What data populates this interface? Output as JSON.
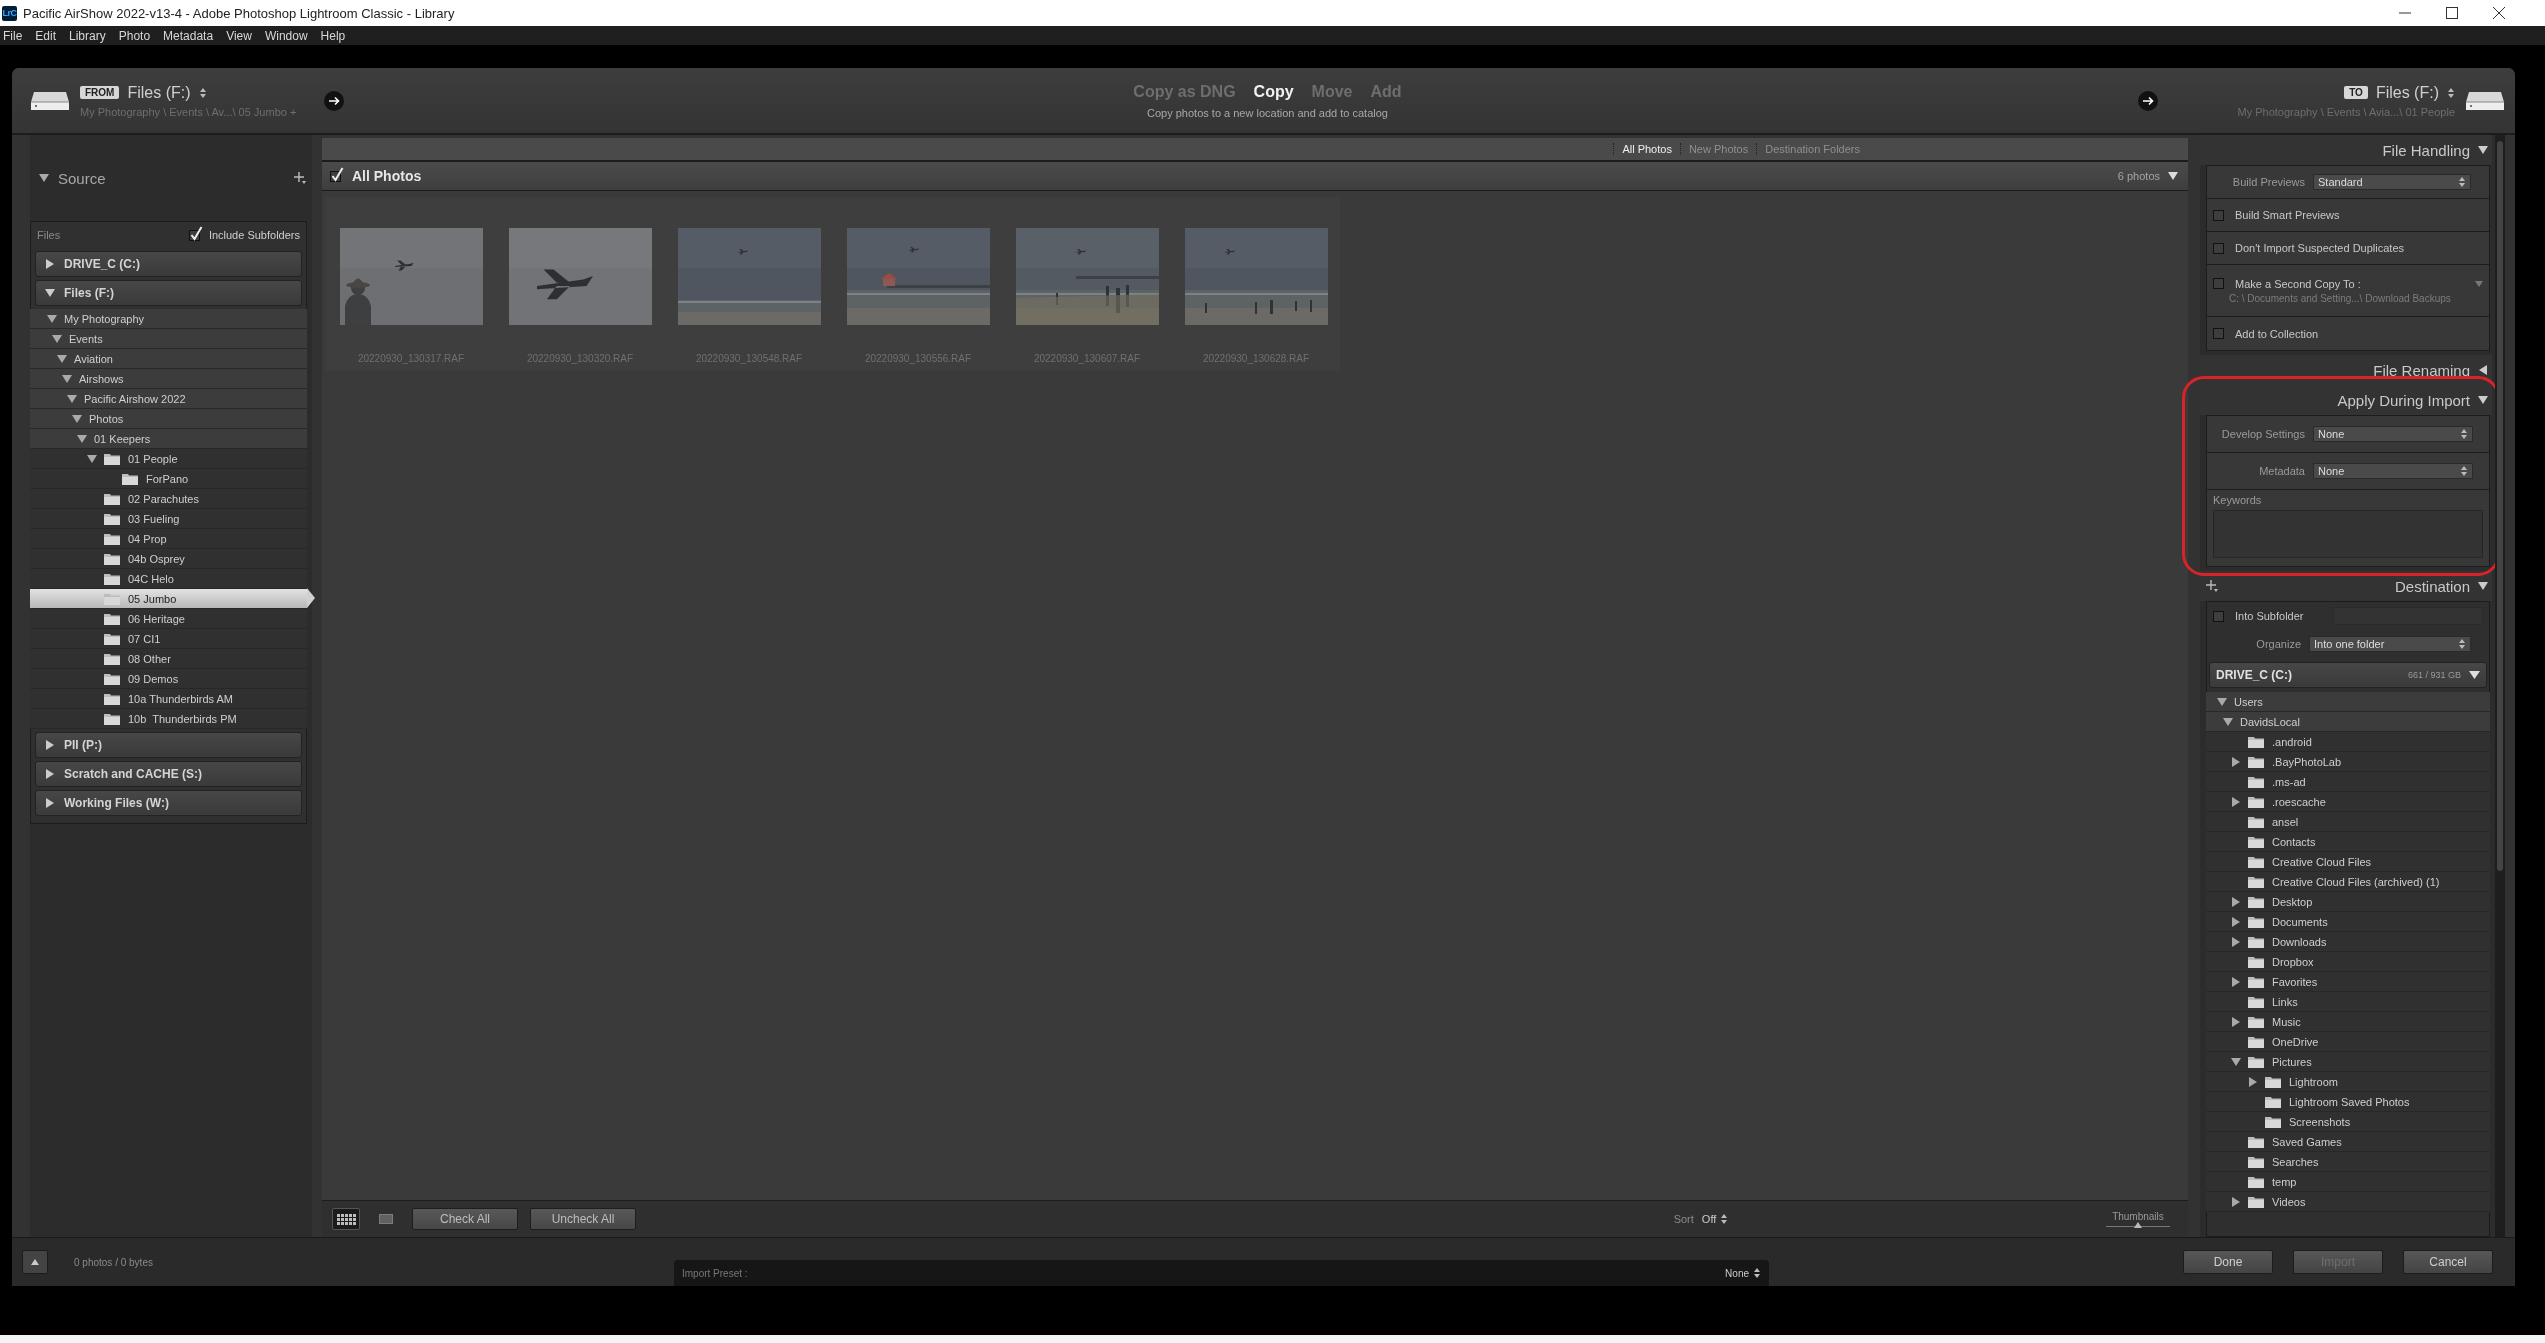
{
  "window": {
    "app_icon": "LrC",
    "title": "Pacific AirShow 2022-v13-4 - Adobe Photoshop Lightroom Classic - Library"
  },
  "menu": [
    "File",
    "Edit",
    "Library",
    "Photo",
    "Metadata",
    "View",
    "Window",
    "Help"
  ],
  "import_header": {
    "from": {
      "badge": "FROM",
      "volume": "Files (F:)",
      "path": "My Photography \\ Events \\ Av...\\ 05 Jumbo +"
    },
    "modes": [
      {
        "label": "Copy as DNG",
        "selected": false
      },
      {
        "label": "Copy",
        "selected": true
      },
      {
        "label": "Move",
        "selected": false
      },
      {
        "label": "Add",
        "selected": false
      }
    ],
    "mode_description": "Copy photos to a new location and add to catalog",
    "to": {
      "badge": "TO",
      "volume": "Files (F:)",
      "path": "My Photography \\ Events \\ Avia...\\ 01 People"
    }
  },
  "source": {
    "title": "Source",
    "files_label": "Files",
    "include_subfolders": {
      "label": "Include Subfolders",
      "checked": true
    },
    "volumes": [
      {
        "name": "DRIVE_C (C:)",
        "expanded": false
      },
      {
        "name": "Files (F:)",
        "expanded": true,
        "children": [
          {
            "name": "My Photography",
            "kind": "path",
            "selected": false,
            "expanded": true,
            "children": [
              {
                "name": "Events",
                "kind": "path",
                "selected": false,
                "expanded": true,
                "children": [
                  {
                    "name": "Aviation",
                    "kind": "path",
                    "selected": false,
                    "expanded": true,
                    "children": [
                      {
                        "name": "Airshows",
                        "kind": "path",
                        "selected": false,
                        "expanded": true,
                        "children": [
                          {
                            "name": "Pacific Airshow 2022",
                            "kind": "path",
                            "selected": false,
                            "expanded": true,
                            "children": [
                              {
                                "name": "Photos",
                                "kind": "path",
                                "selected": false,
                                "expanded": true,
                                "children": [
                                  {
                                    "name": "01 Keepers",
                                    "kind": "path",
                                    "selected": false,
                                    "expanded": true,
                                    "children": [
                                      {
                                        "name": "01 People",
                                        "kind": "folder",
                                        "selected": false,
                                        "expanded": true,
                                        "children": [
                                          {
                                            "name": "ForPano",
                                            "kind": "folder",
                                            "selected": false
                                          }
                                        ]
                                      },
                                      {
                                        "name": "02 Parachutes",
                                        "kind": "folder",
                                        "selected": false
                                      },
                                      {
                                        "name": "03 Fueling",
                                        "kind": "folder",
                                        "selected": false
                                      },
                                      {
                                        "name": "04 Prop",
                                        "kind": "folder",
                                        "selected": false
                                      },
                                      {
                                        "name": "04b Osprey",
                                        "kind": "folder",
                                        "selected": false
                                      },
                                      {
                                        "name": "04C Helo",
                                        "kind": "folder",
                                        "selected": false
                                      },
                                      {
                                        "name": "05 Jumbo",
                                        "kind": "folder",
                                        "selected": true
                                      },
                                      {
                                        "name": "06 Heritage",
                                        "kind": "folder",
                                        "selected": false
                                      },
                                      {
                                        "name": "07 CI1",
                                        "kind": "folder",
                                        "selected": false
                                      },
                                      {
                                        "name": "08 Other",
                                        "kind": "folder",
                                        "selected": false
                                      },
                                      {
                                        "name": "09 Demos",
                                        "kind": "folder",
                                        "selected": false
                                      },
                                      {
                                        "name": "10a Thunderbirds AM",
                                        "kind": "folder",
                                        "selected": false
                                      },
                                      {
                                        "name": "10b  Thunderbirds PM",
                                        "kind": "folder",
                                        "selected": false
                                      }
                                    ]
                                  }
                                ]
                              }
                            ]
                          }
                        ]
                      }
                    ]
                  }
                ]
              }
            ]
          }
        ]
      },
      {
        "name": "PII (P:)",
        "expanded": false
      },
      {
        "name": "Scratch and CACHE (S:)",
        "expanded": false
      },
      {
        "name": "Working Files (W:)",
        "expanded": false
      }
    ]
  },
  "tabs": [
    {
      "label": "All Photos",
      "selected": true
    },
    {
      "label": "New Photos",
      "selected": false
    },
    {
      "label": "Destination Folders",
      "selected": false
    }
  ],
  "grid": {
    "checked": true,
    "title": "All Photos",
    "count": "6 photos",
    "photos": [
      {
        "file": "20220930_130317.RAF",
        "kind": "picture"
      },
      {
        "file": "20220930_130320.RAF",
        "kind": "picture"
      },
      {
        "file": "20220930_130548.RAF",
        "kind": "picture"
      },
      {
        "file": "20220930_130556.RAF",
        "kind": "picture"
      },
      {
        "file": "20220930_130607.RAF",
        "kind": "picture"
      },
      {
        "file": "20220930_130628.RAF",
        "kind": "picture"
      }
    ]
  },
  "toolbar": {
    "view_modes": [
      {
        "kind": "grid",
        "selected": true
      },
      {
        "kind": "loupe",
        "selected": false
      }
    ],
    "buttons": [
      "Check All",
      "Uncheck All"
    ],
    "sort_label": "Sort",
    "sort_value": "Off",
    "thumbnails": {
      "label": "Thumbnails",
      "level": 0.5
    }
  },
  "file_handling": {
    "title": "File Handling",
    "expanded": true,
    "build_previews": {
      "label": "Build Previews",
      "value": "Standard"
    },
    "options": [
      {
        "label": "Build Smart Previews",
        "checked": false
      },
      {
        "label": "Don't Import Suspected Duplicates",
        "checked": false
      },
      {
        "label": "Make a Second Copy To :",
        "checked": false,
        "path": "C: \\ Documents and Setting...\\ Download Backups"
      },
      {
        "label": "Add to Collection",
        "checked": false
      }
    ]
  },
  "file_renaming": {
    "title": "File Renaming",
    "expanded": false
  },
  "apply_during_import": {
    "title": "Apply During Import",
    "expanded": true,
    "highlighted": true,
    "develop_settings": {
      "label": "Develop Settings",
      "value": "None"
    },
    "metadata": {
      "label": "Metadata",
      "value": "None"
    },
    "keywords": {
      "label": "Keywords"
    }
  },
  "destination": {
    "title": "Destination",
    "expanded": true,
    "into_subfolder": {
      "label": "Into Subfolder",
      "checked": false
    },
    "organize": {
      "label": "Organize",
      "value": "Into one folder"
    },
    "volume": {
      "name": "DRIVE_C (C:)",
      "space": "661 / 931 GB",
      "expanded": true
    },
    "tree": [
      {
        "name": "Users",
        "kind": "path",
        "selected": false,
        "expanded": true,
        "children": [
          {
            "name": "DavidsLocal",
            "kind": "path",
            "selected": false,
            "expanded": true,
            "children": [
              {
                "name": ".android",
                "kind": "folder",
                "selected": false
              },
              {
                "name": ".BayPhotoLab",
                "kind": "folder",
                "selected": false,
                "expanded": false
              },
              {
                "name": ".ms-ad",
                "kind": "folder",
                "selected": false
              },
              {
                "name": ".roescache",
                "kind": "folder",
                "selected": false,
                "expanded": false
              },
              {
                "name": "ansel",
                "kind": "folder",
                "selected": false
              },
              {
                "name": "Contacts",
                "kind": "folder",
                "selected": false
              },
              {
                "name": "Creative Cloud Files",
                "kind": "folder",
                "selected": false
              },
              {
                "name": "Creative Cloud Files (archived) (1)",
                "kind": "folder",
                "selected": false
              },
              {
                "name": "Desktop",
                "kind": "folder",
                "selected": false,
                "expanded": false
              },
              {
                "name": "Documents",
                "kind": "folder",
                "selected": false,
                "expanded": false
              },
              {
                "name": "Downloads",
                "kind": "folder",
                "selected": false,
                "expanded": false
              },
              {
                "name": "Dropbox",
                "kind": "folder",
                "selected": false
              },
              {
                "name": "Favorites",
                "kind": "folder",
                "selected": false,
                "expanded": false
              },
              {
                "name": "Links",
                "kind": "folder",
                "selected": false
              },
              {
                "name": "Music",
                "kind": "folder",
                "selected": false,
                "expanded": false
              },
              {
                "name": "OneDrive",
                "kind": "folder",
                "selected": false
              },
              {
                "name": "Pictures",
                "kind": "folder",
                "selected": false,
                "expanded": true,
                "children": [
                  {
                    "name": "Lightroom",
                    "kind": "folder",
                    "selected": false,
                    "expanded": false
                  },
                  {
                    "name": "Lightroom Saved Photos",
                    "kind": "folder",
                    "selected": false
                  },
                  {
                    "name": "Screenshots",
                    "kind": "folder",
                    "selected": false
                  }
                ]
              },
              {
                "name": "Saved Games",
                "kind": "folder",
                "selected": false
              },
              {
                "name": "Searches",
                "kind": "folder",
                "selected": false
              },
              {
                "name": "temp",
                "kind": "folder",
                "selected": false
              },
              {
                "name": "Videos",
                "kind": "folder",
                "selected": false,
                "expanded": false
              }
            ]
          }
        ]
      }
    ]
  },
  "footer": {
    "status": "0 photos / 0 bytes",
    "import_preset": {
      "label": "Import Preset :",
      "value": "None"
    },
    "buttons": [
      {
        "label": "Done",
        "disabled": false
      },
      {
        "label": "Import",
        "disabled": true
      },
      {
        "label": "Cancel",
        "disabled": false
      }
    ]
  }
}
